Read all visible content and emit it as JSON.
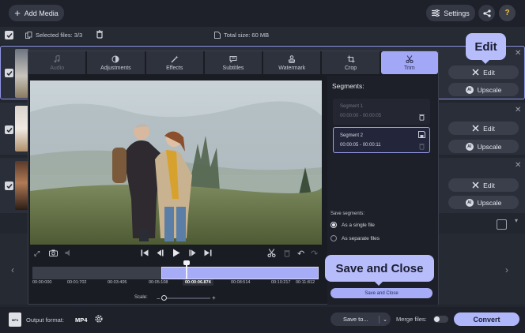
{
  "toolbar": {
    "add_media": "Add Media",
    "settings": "Settings"
  },
  "selection": {
    "selected_files": "Selected files: 3/3",
    "total_size": "Total size: 60 MB"
  },
  "rows": [
    {
      "edit": "Edit",
      "upscale": "Upscale"
    },
    {
      "edit": "Edit",
      "upscale": "Upscale"
    },
    {
      "edit": "Edit",
      "upscale": "Upscale"
    }
  ],
  "tabs": [
    {
      "label": "Audio",
      "icon": "music-note-icon"
    },
    {
      "label": "Adjustments",
      "icon": "contrast-icon"
    },
    {
      "label": "Effects",
      "icon": "magic-wand-icon"
    },
    {
      "label": "Subtitles",
      "icon": "speech-bubble-icon"
    },
    {
      "label": "Watermark",
      "icon": "stamp-icon"
    },
    {
      "label": "Crop",
      "icon": "crop-icon"
    },
    {
      "label": "Trim",
      "icon": "scissors-icon"
    }
  ],
  "segments": {
    "title": "Segments:",
    "items": [
      {
        "name": "Segment 1",
        "range": "00:00:00 - 00:00:05"
      },
      {
        "name": "Segment 2",
        "range": "00:00:05 - 00:00:11"
      }
    ],
    "save_label": "Save segments:",
    "options": [
      "As a single file",
      "As separate files"
    ],
    "selected_option": 0,
    "save_close_button": "Save and Close"
  },
  "timeline": {
    "current_time": "00:00:06.874",
    "ticks": [
      "00:00:000",
      "00:01:702",
      "00:03:405",
      "00:05:108",
      "00:06.874",
      "00:08:514",
      "00:10:217",
      "00:11:812"
    ],
    "scale_label": "Scale:",
    "selection_start_fraction": 0.45,
    "playhead_fraction": 0.54
  },
  "callouts": {
    "edit": "Edit",
    "save_close": "Save and Close"
  },
  "bottom": {
    "output_format_label": "Output format:",
    "output_format_value": "MP4",
    "save_to": "Save to...",
    "merge_files": "Merge files:",
    "convert": "Convert"
  },
  "colors": {
    "accent": "#a2a8f6",
    "convert": "#b0b6fa",
    "background": "#22262f"
  }
}
